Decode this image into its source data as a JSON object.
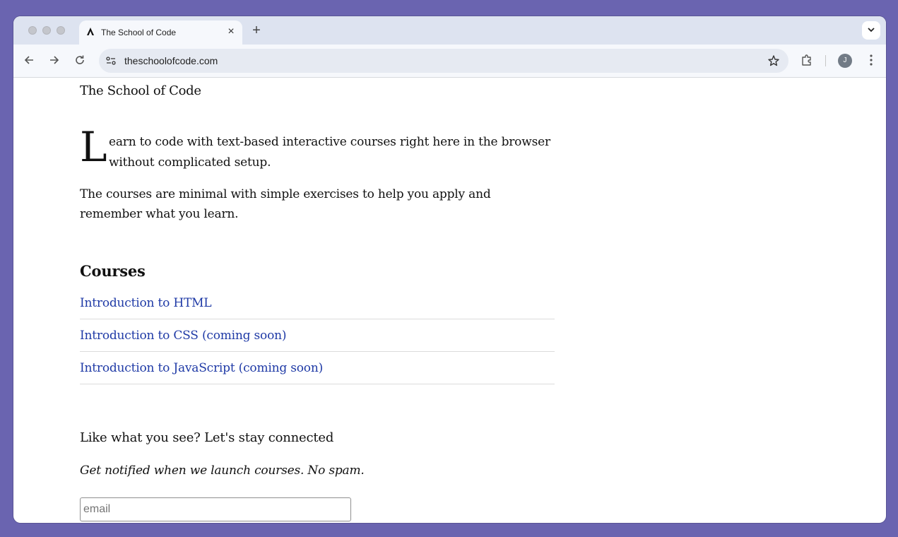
{
  "browser": {
    "tab_title": "The School of Code",
    "url": "theschoolofcode.com",
    "avatar_initial": "J",
    "icons": [
      "back-icon",
      "forward-icon",
      "reload-icon",
      "site-info-icon",
      "star-icon",
      "extensions-icon",
      "kebab-menu-icon",
      "tab-search-icon",
      "new-tab-icon",
      "close-icon"
    ]
  },
  "page": {
    "site_title": "The School of Code",
    "intro_dropcap": "L",
    "intro_rest": "earn to code with text-based interactive courses right here in the browser without complicated setup.",
    "intro_second": "The courses are minimal with simple exercises to help you apply and remember what you learn.",
    "courses_heading": "Courses",
    "courses": [
      {
        "label": "Introduction to HTML"
      },
      {
        "label": "Introduction to CSS (coming soon)"
      },
      {
        "label": "Introduction to JavaScript (coming soon)"
      }
    ],
    "connect_heading": "Like what you see? Let's stay connected",
    "notify_text": "Get notified when we launch courses. No spam.",
    "email_placeholder": "email"
  },
  "colors": {
    "link": "#1f3aa6",
    "background": "#6a64b0"
  }
}
